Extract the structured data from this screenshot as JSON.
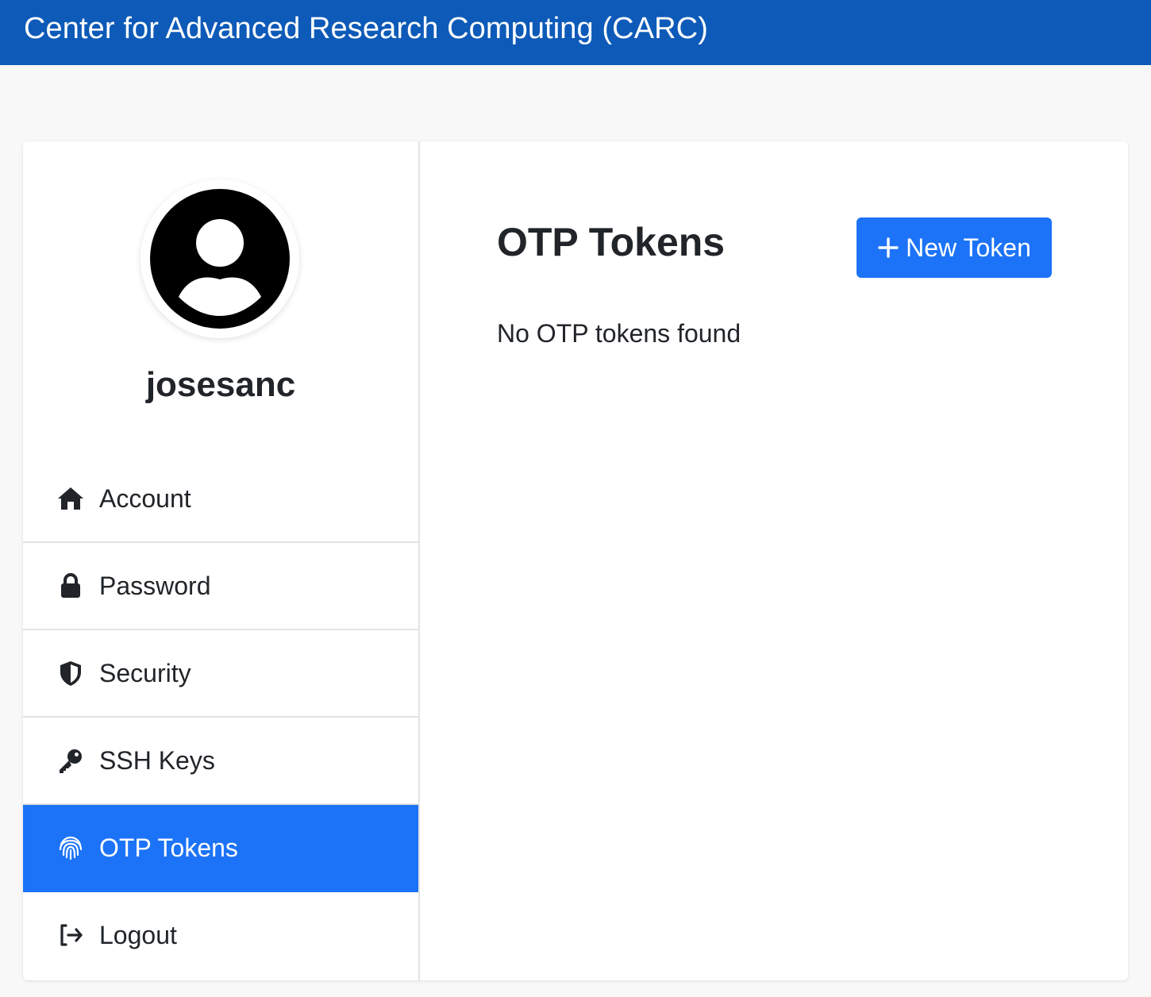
{
  "header": {
    "title": "Center for Advanced Research Computing (CARC)",
    "background_color": "#0d5ab8"
  },
  "profile": {
    "avatar_icon": "user-circle-icon",
    "username": "josesanc"
  },
  "sidebar": {
    "active_color": "#1c73f7",
    "items": [
      {
        "label": "Account",
        "icon": "home-icon",
        "active": false
      },
      {
        "label": "Password",
        "icon": "lock-icon",
        "active": false
      },
      {
        "label": "Security",
        "icon": "shield-icon",
        "active": false
      },
      {
        "label": "SSH Keys",
        "icon": "key-icon",
        "active": false
      },
      {
        "label": "OTP Tokens",
        "icon": "fingerprint-icon",
        "active": true
      },
      {
        "label": "Logout",
        "icon": "logout-icon",
        "active": false
      }
    ]
  },
  "main": {
    "title": "OTP Tokens",
    "new_button_label": "New Token",
    "new_button_icon": "plus-icon",
    "empty_message": "No OTP tokens found"
  }
}
